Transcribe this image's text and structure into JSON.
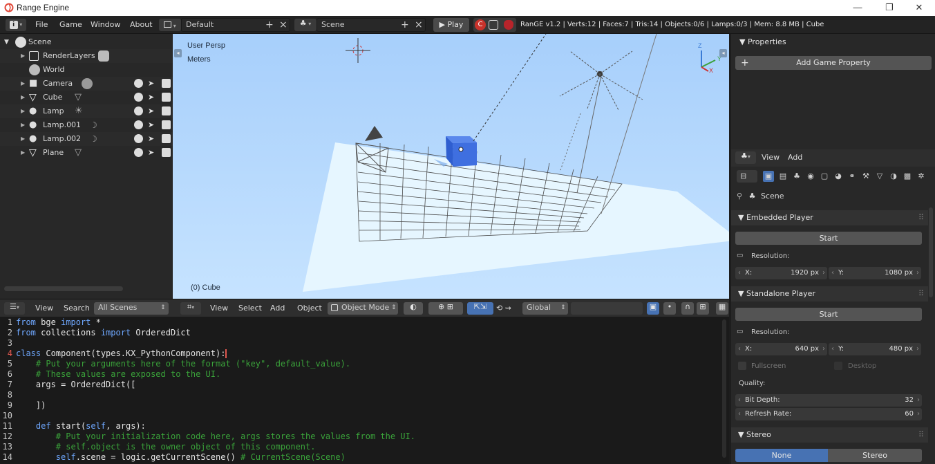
{
  "titlebar": {
    "title": "Range Engine",
    "minimize": "—",
    "maximize": "❐",
    "close": "✕"
  },
  "menu": {
    "file": "File",
    "game": "Game",
    "window": "Window",
    "about": "About"
  },
  "workspace": {
    "name": "Default",
    "add": "+",
    "close": "×"
  },
  "scene_selector": {
    "name": "Scene",
    "add": "+",
    "close": "×"
  },
  "play": {
    "label": "Play"
  },
  "stats": "RanGE v1.2 | Verts:12 | Faces:7 | Tris:14 | Objects:0/6 | Lamps:0/3 | Mem: 8.8 MB | Cube",
  "outliner": {
    "root": "Scene",
    "items": [
      {
        "label": "RenderLayers"
      },
      {
        "label": "World"
      },
      {
        "label": "Camera"
      },
      {
        "label": "Cube"
      },
      {
        "label": "Lamp"
      },
      {
        "label": "Lamp.001"
      },
      {
        "label": "Lamp.002"
      },
      {
        "label": "Plane"
      }
    ]
  },
  "viewport": {
    "view_name": "User Persp",
    "units": "Meters",
    "object_label": "(0) Cube",
    "axis_z": "Z",
    "axis_y": "Y",
    "axis_x": "X"
  },
  "outliner_header": {
    "view": "View",
    "search": "Search",
    "filter": "All Scenes"
  },
  "viewport_header": {
    "view": "View",
    "select": "Select",
    "add": "Add",
    "object": "Object",
    "mode": "Object Mode",
    "orientation": "Global"
  },
  "editor": {
    "lines": [
      {
        "n": "1",
        "parts": [
          [
            "kw",
            "from"
          ],
          [
            "t",
            " bge "
          ],
          [
            "kw",
            "import"
          ],
          [
            "t",
            " *"
          ]
        ]
      },
      {
        "n": "2",
        "parts": [
          [
            "kw",
            "from"
          ],
          [
            "t",
            " collections "
          ],
          [
            "kw",
            "import"
          ],
          [
            "t",
            " OrderedDict"
          ]
        ]
      },
      {
        "n": "3",
        "parts": [
          [
            "t",
            ""
          ]
        ]
      },
      {
        "n": "4",
        "parts": [
          [
            "kw",
            "class"
          ],
          [
            "t",
            " Component(types.KX_PythonComponent):"
          ]
        ]
      },
      {
        "n": "5",
        "parts": [
          [
            "t",
            "    "
          ],
          [
            "cm",
            "# Put your arguments here of the format (\"key\", default_value)."
          ]
        ]
      },
      {
        "n": "6",
        "parts": [
          [
            "t",
            "    "
          ],
          [
            "cm",
            "# These values are exposed to the UI."
          ]
        ]
      },
      {
        "n": "7",
        "parts": [
          [
            "t",
            "    args = OrderedDict(["
          ]
        ]
      },
      {
        "n": "8",
        "parts": [
          [
            "t",
            ""
          ]
        ]
      },
      {
        "n": "9",
        "parts": [
          [
            "t",
            "    ])"
          ]
        ]
      },
      {
        "n": "10",
        "parts": [
          [
            "t",
            ""
          ]
        ]
      },
      {
        "n": "11",
        "parts": [
          [
            "t",
            "    "
          ],
          [
            "kw",
            "def"
          ],
          [
            "t",
            " start("
          ],
          [
            "kw",
            "self"
          ],
          [
            "t",
            ", args):"
          ]
        ]
      },
      {
        "n": "12",
        "parts": [
          [
            "t",
            "        "
          ],
          [
            "cm",
            "# Put your initialization code here, args stores the values from the UI."
          ]
        ]
      },
      {
        "n": "13",
        "parts": [
          [
            "t",
            "        "
          ],
          [
            "cm",
            "# self.object is the owner object of this component."
          ]
        ]
      },
      {
        "n": "14",
        "parts": [
          [
            "t",
            "        "
          ],
          [
            "kw",
            "self"
          ],
          [
            "t",
            ".scene = logic.getCurrentScene() "
          ],
          [
            "cm",
            "# CurrentScene(Scene)"
          ]
        ]
      }
    ]
  },
  "properties": {
    "title": "Properties",
    "add_game_property": "Add Game Property"
  },
  "props_editor": {
    "view": "View",
    "add": "Add",
    "context": "Scene"
  },
  "embedded": {
    "title": "Embedded Player",
    "start": "Start",
    "resolution": "Resolution:",
    "x_label": "X:",
    "x_value": "1920 px",
    "y_label": "Y:",
    "y_value": "1080 px"
  },
  "standalone": {
    "title": "Standalone Player",
    "start": "Start",
    "resolution": "Resolution:",
    "x_label": "X:",
    "x_value": "640 px",
    "y_label": "Y:",
    "y_value": "480 px",
    "fullscreen": "Fullscreen",
    "desktop": "Desktop",
    "quality": "Quality:",
    "bit_depth_label": "Bit Depth:",
    "bit_depth_value": "32",
    "refresh_label": "Refresh Rate:",
    "refresh_value": "60"
  },
  "stereo": {
    "title": "Stereo",
    "none": "None",
    "stereo": "Stereo"
  },
  "colors": {
    "accent": "#4772b3",
    "selected_cube": "#3f6fe0",
    "viewport_bg": "#b8daff"
  }
}
